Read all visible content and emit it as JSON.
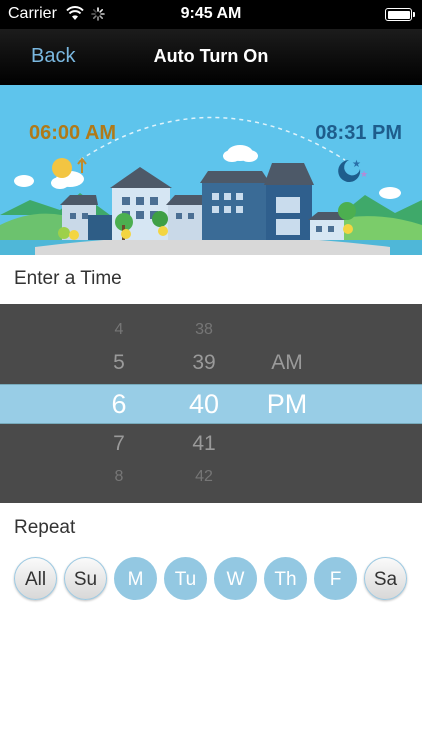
{
  "status_bar": {
    "carrier": "Carrier",
    "time": "9:45 AM"
  },
  "nav": {
    "back_label": "Back",
    "title": "Auto Turn On"
  },
  "banner": {
    "sunrise_time": "06:00 AM",
    "sunset_time": "08:31 PM"
  },
  "time_section": {
    "label": "Enter a Time"
  },
  "picker": {
    "hours": [
      "4",
      "5",
      "6",
      "7",
      "8"
    ],
    "minutes": [
      "38",
      "39",
      "40",
      "41",
      "42"
    ],
    "ampm": [
      "AM",
      "PM"
    ],
    "selected": {
      "hour": "6",
      "minute": "40",
      "ampm": "PM"
    }
  },
  "repeat_section": {
    "label": "Repeat"
  },
  "days": [
    {
      "label": "All",
      "selected": false
    },
    {
      "label": "Su",
      "selected": false
    },
    {
      "label": "M",
      "selected": true
    },
    {
      "label": "Tu",
      "selected": true
    },
    {
      "label": "W",
      "selected": true
    },
    {
      "label": "Th",
      "selected": true
    },
    {
      "label": "F",
      "selected": true
    },
    {
      "label": "Sa",
      "selected": false
    }
  ],
  "colors": {
    "accent": "#93c8e2",
    "back_link": "#7ab8e0",
    "sky": "#5ec4ec",
    "picker_bg": "#4a4a4a"
  }
}
